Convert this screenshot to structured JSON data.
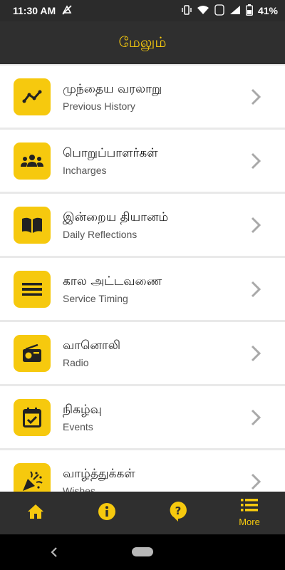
{
  "status_bar": {
    "time": "11:30 AM",
    "battery": "41%"
  },
  "app_bar": {
    "title": "மேலும்"
  },
  "menu": [
    {
      "tamil": "முந்தைய வரலாறு",
      "english": "Previous History",
      "icon": "trend-line-icon"
    },
    {
      "tamil": "பொறுப்பாளர்கள்",
      "english": "Incharges",
      "icon": "people-icon"
    },
    {
      "tamil": "இன்றைய தியானம்",
      "english": "Daily Reflections",
      "icon": "open-book-icon"
    },
    {
      "tamil": "கால அட்டவணை",
      "english": "Service Timing",
      "icon": "timetable-icon"
    },
    {
      "tamil": "வானொலி",
      "english": "Radio",
      "icon": "radio-icon"
    },
    {
      "tamil": "நிகழ்வு",
      "english": "Events",
      "icon": "calendar-check-icon"
    },
    {
      "tamil": "வாழ்த்துக்கள்",
      "english": "Wishes",
      "icon": "party-popper-icon"
    }
  ],
  "bottom_nav": {
    "items": [
      {
        "icon": "home-icon",
        "label": ""
      },
      {
        "icon": "info-icon",
        "label": ""
      },
      {
        "icon": "help-icon",
        "label": ""
      },
      {
        "icon": "list-icon",
        "label": "More"
      }
    ],
    "active_index": 3
  },
  "colors": {
    "accent": "#f6c90e",
    "bar": "#2f2f2f",
    "background": "#e9e9e9"
  }
}
